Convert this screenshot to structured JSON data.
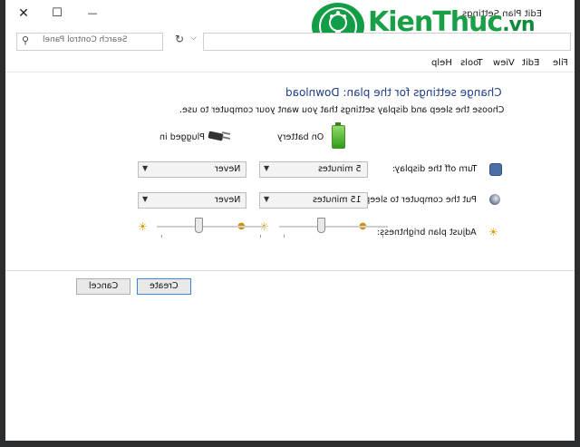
{
  "window": {
    "title": "Edit Plan Settings",
    "close_glyph": "✕",
    "maximize_glyph": "☐",
    "minimize_glyph": "—"
  },
  "watermark": {
    "brand": "KienThuc",
    "domain": ".vn",
    "accent": "#19a046"
  },
  "address": {
    "search_placeholder": "Search Control Panel",
    "search_icon": "search-icon",
    "refresh_glyph": "↻",
    "dropdown_glyph": "⌵"
  },
  "menu": {
    "file": "File",
    "edit": "Edit",
    "view": "View",
    "tools": "Tools",
    "help": "Help"
  },
  "plan": {
    "heading": "Change settings for the plan: Download",
    "subheading": "Choose the sleep and display settings that you want your computer to use.",
    "on_battery_label": "On battery",
    "plugged_in_label": "Plugged in",
    "display": {
      "label": "Turn off the display:",
      "battery_value": "5 minutes",
      "plugged_value": "Never"
    },
    "sleep": {
      "label": "Put the computer to sleep:",
      "battery_value": "15 minutes",
      "plugged_value": "Never"
    },
    "brightness": {
      "label": "Adjust plan brightness:",
      "battery_level": 0.62,
      "plugged_level": 0.62
    }
  },
  "buttons": {
    "create": "Create",
    "cancel": "Cancel"
  },
  "colors": {
    "heading": "#1e3b87",
    "button_focus": "#3c86d6"
  }
}
